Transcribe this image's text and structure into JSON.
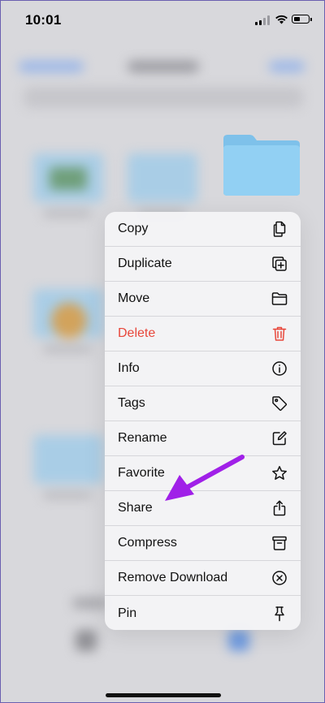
{
  "status_bar": {
    "time": "10:01"
  },
  "context_menu": {
    "items": [
      {
        "label": "Copy",
        "icon": "copy-icon"
      },
      {
        "label": "Duplicate",
        "icon": "duplicate-icon"
      },
      {
        "label": "Move",
        "icon": "folder-icon"
      },
      {
        "label": "Delete",
        "icon": "trash-icon",
        "destructive": true
      },
      {
        "label": "Info",
        "icon": "info-icon"
      },
      {
        "label": "Tags",
        "icon": "tag-icon"
      },
      {
        "label": "Rename",
        "icon": "rename-icon"
      },
      {
        "label": "Favorite",
        "icon": "star-icon"
      },
      {
        "label": "Share",
        "icon": "share-icon"
      },
      {
        "label": "Compress",
        "icon": "archive-icon"
      },
      {
        "label": "Remove Download",
        "icon": "remove-download-icon"
      },
      {
        "label": "Pin",
        "icon": "pin-icon"
      }
    ]
  },
  "colors": {
    "destructive": "#e8473b",
    "folder": "#8ccbf0",
    "annotation_arrow": "#a020e8"
  }
}
